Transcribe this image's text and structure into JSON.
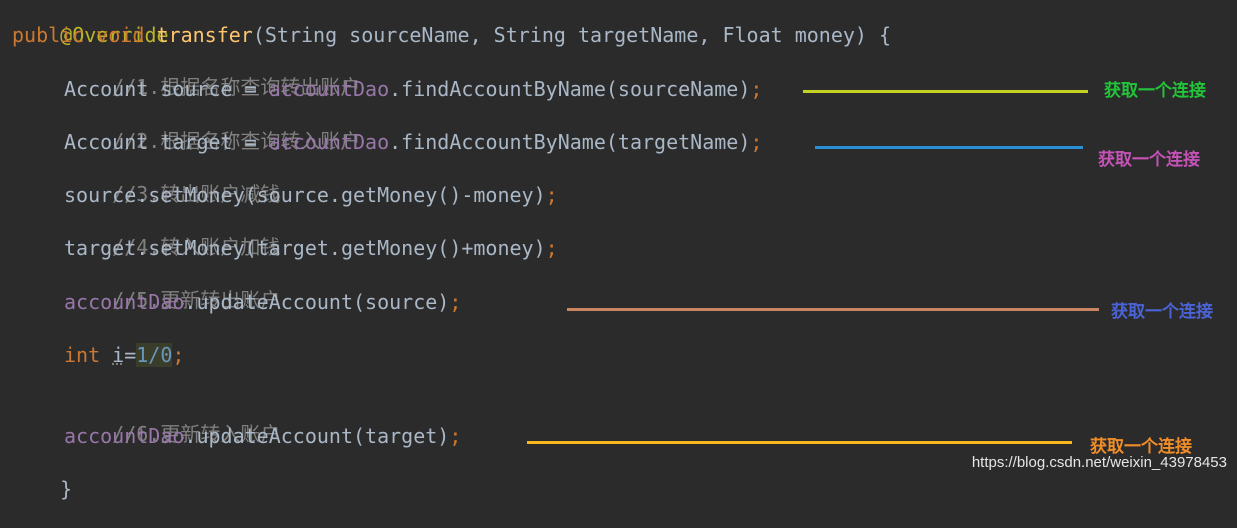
{
  "code": {
    "annotation": "@Override",
    "signature": {
      "public": "public",
      "void": "void",
      "name": "transfer",
      "params": "(String sourceName, String targetName, Float money) {"
    },
    "c1": "//1.根据名称查询转出账户",
    "l1": {
      "type": "Account",
      "rest": " source = ",
      "dao": "accountDao",
      "call": ".findAccountByName(sourceName)",
      "semi": ";"
    },
    "c2": "//2.根据名称查询转入账户",
    "l2": {
      "type": "Account",
      "rest": " target = ",
      "dao": "accountDao",
      "call": ".findAccountByName(targetName)",
      "semi": ";"
    },
    "c3": "//3.转出账户减钱",
    "l3": {
      "body": "source.setMoney(source.getMoney()-money)",
      "semi": ";"
    },
    "c4": "//4.转入账户加钱",
    "l4": {
      "body": "target.setMoney(target.getMoney()+money)",
      "semi": ";"
    },
    "c5": "//5.更新转出账户",
    "l5": {
      "dao": "accountDao",
      "call": ".updateAccount(source)",
      "semi": ";"
    },
    "l6": {
      "kw": "int",
      "sp": " ",
      "var": "i",
      "eq": "=",
      "expr": "1/0",
      "semi": ";"
    },
    "c6": "//6.更新转入账户",
    "l7": {
      "dao": "accountDao",
      "call": ".updateAccount(target)",
      "semi": ";"
    },
    "close": "}"
  },
  "annotations": [
    {
      "label": "获取一个连接",
      "line_color": "#c4d322",
      "text_color": "#22c43a"
    },
    {
      "label": "获取一个连接",
      "line_color": "#2b8fd6",
      "text_color": "#c552b7"
    },
    {
      "label": "获取一个连接",
      "line_color": "#c88560",
      "text_color": "#4a64d8"
    },
    {
      "label": "获取一个连接",
      "line_color": "#f6b81b",
      "text_color": "#f08d28"
    }
  ],
  "watermark": "https://blog.csdn.net/weixin_43978453"
}
